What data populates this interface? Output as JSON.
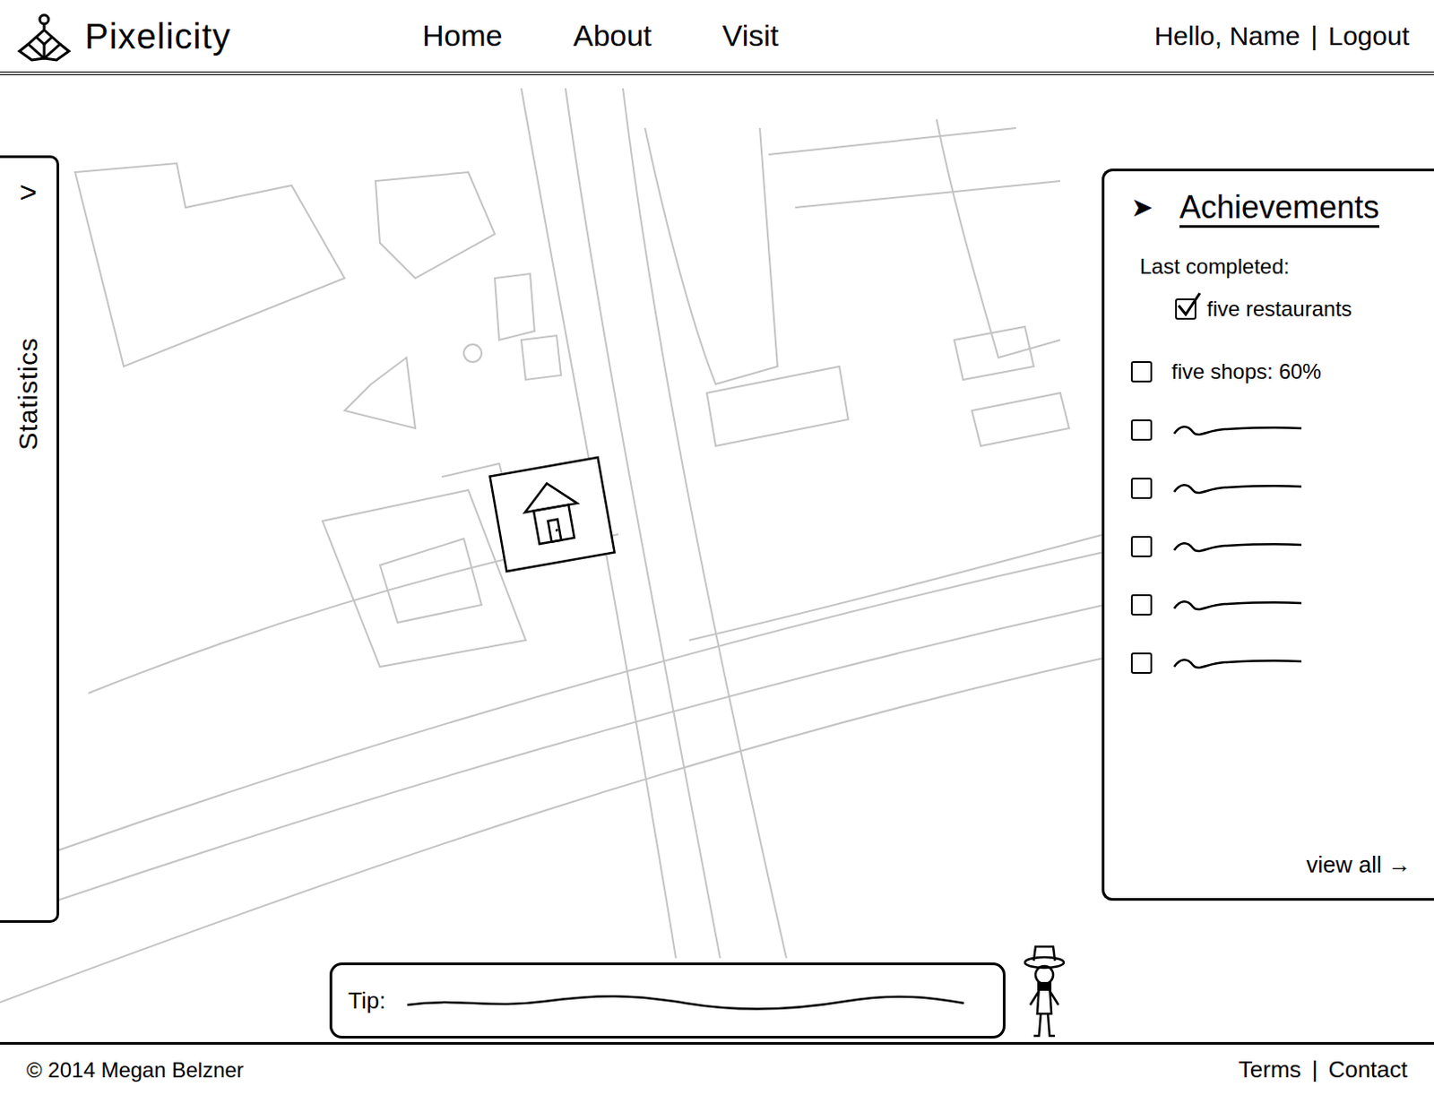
{
  "header": {
    "logo_text": "Pixelicity",
    "nav": [
      {
        "label": "Home"
      },
      {
        "label": "About"
      },
      {
        "label": "Visit"
      }
    ],
    "greeting": "Hello, Name",
    "separator": "|",
    "logout": "Logout"
  },
  "statistics": {
    "toggle": ">",
    "label": "Statistics"
  },
  "achievements": {
    "toggle": "➤",
    "title": "Achievements",
    "last_completed_label": "Last completed:",
    "last_completed": {
      "label": "five restaurants",
      "checked": true
    },
    "items": [
      {
        "kind": "text",
        "label": "five shops: 60%",
        "checked": false
      },
      {
        "kind": "squiggle",
        "checked": false
      },
      {
        "kind": "squiggle",
        "checked": false
      },
      {
        "kind": "squiggle",
        "checked": false
      },
      {
        "kind": "squiggle",
        "checked": false
      },
      {
        "kind": "squiggle",
        "checked": false
      }
    ],
    "view_all": "view all →"
  },
  "tip": {
    "label": "Tip:"
  },
  "footer": {
    "copyright": "© 2014 Megan Belzner",
    "links": [
      "Terms",
      "Contact"
    ],
    "separator": "|"
  }
}
